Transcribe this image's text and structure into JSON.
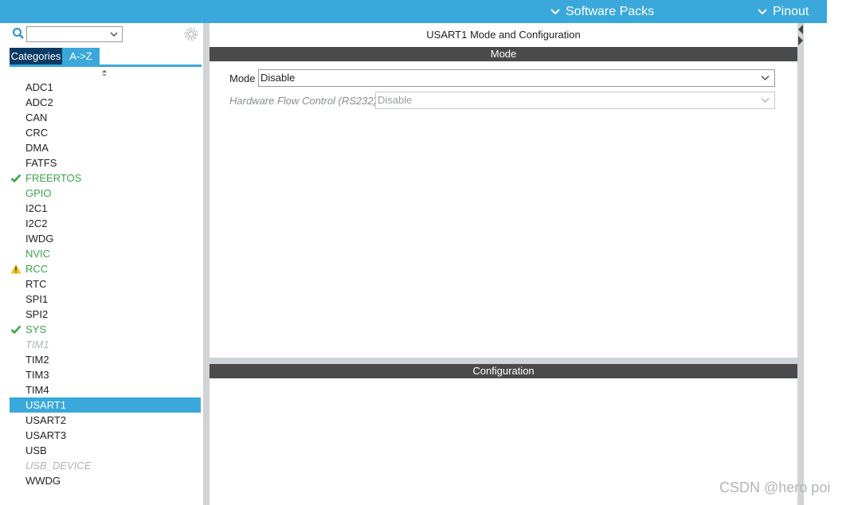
{
  "topbar": {
    "software_packs_label": "Software Packs",
    "pinout_label": "Pinout",
    "color": "#3aa8da"
  },
  "left_panel": {
    "search": {
      "value": "",
      "placeholder": ""
    },
    "tabs": [
      {
        "label": "Categories",
        "active": false
      },
      {
        "label": "A->Z",
        "active": true
      }
    ],
    "items": [
      {
        "label": "ADC1",
        "state": "normal",
        "status_icon": ""
      },
      {
        "label": "ADC2",
        "state": "normal",
        "status_icon": ""
      },
      {
        "label": "CAN",
        "state": "normal",
        "status_icon": ""
      },
      {
        "label": "CRC",
        "state": "normal",
        "status_icon": ""
      },
      {
        "label": "DMA",
        "state": "normal",
        "status_icon": ""
      },
      {
        "label": "FATFS",
        "state": "normal",
        "status_icon": ""
      },
      {
        "label": "FREERTOS",
        "state": "green",
        "status_icon": "check-icon"
      },
      {
        "label": "GPIO",
        "state": "green",
        "status_icon": ""
      },
      {
        "label": "I2C1",
        "state": "normal",
        "status_icon": ""
      },
      {
        "label": "I2C2",
        "state": "normal",
        "status_icon": ""
      },
      {
        "label": "IWDG",
        "state": "normal",
        "status_icon": ""
      },
      {
        "label": "NVIC",
        "state": "green",
        "status_icon": ""
      },
      {
        "label": "RCC",
        "state": "green",
        "status_icon": "warning-icon"
      },
      {
        "label": "RTC",
        "state": "normal",
        "status_icon": ""
      },
      {
        "label": "SPI1",
        "state": "normal",
        "status_icon": ""
      },
      {
        "label": "SPI2",
        "state": "normal",
        "status_icon": ""
      },
      {
        "label": "SYS",
        "state": "green",
        "status_icon": "check-icon"
      },
      {
        "label": "TIM1",
        "state": "gray",
        "status_icon": ""
      },
      {
        "label": "TIM2",
        "state": "normal",
        "status_icon": ""
      },
      {
        "label": "TIM3",
        "state": "normal",
        "status_icon": ""
      },
      {
        "label": "TIM4",
        "state": "normal",
        "status_icon": ""
      },
      {
        "label": "USART1",
        "state": "selected",
        "status_icon": ""
      },
      {
        "label": "USART2",
        "state": "normal",
        "status_icon": ""
      },
      {
        "label": "USART3",
        "state": "normal",
        "status_icon": ""
      },
      {
        "label": "USB",
        "state": "normal",
        "status_icon": ""
      },
      {
        "label": "USB_DEVICE",
        "state": "gray",
        "status_icon": ""
      },
      {
        "label": "WWDG",
        "state": "normal",
        "status_icon": ""
      }
    ]
  },
  "main": {
    "title": "USART1 Mode and Configuration",
    "mode_section_label": "Mode",
    "mode_label": "Mode",
    "mode_value": "Disable",
    "hw_flow_label": "Hardware Flow Control (RS232)",
    "hw_flow_value": "Disable",
    "config_section_label": "Configuration"
  },
  "watermark": "CSDN @hero poi"
}
